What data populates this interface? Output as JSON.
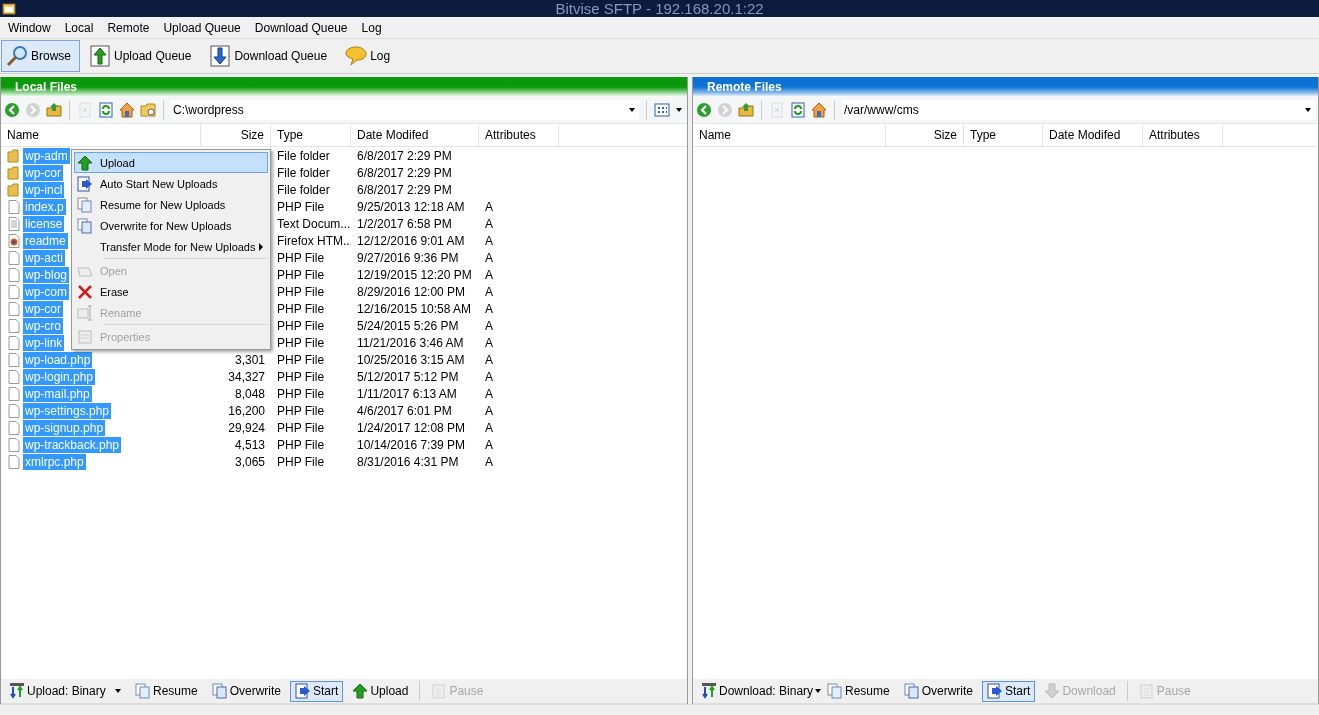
{
  "window": {
    "title": "Bitvise SFTP - 192.168.20.1:22"
  },
  "menu_bar": [
    "Window",
    "Local",
    "Remote",
    "Upload Queue",
    "Download Queue",
    "Log"
  ],
  "toolbar": [
    {
      "label": "Browse",
      "selected": true
    },
    {
      "label": "Upload Queue",
      "selected": false
    },
    {
      "label": "Download Queue",
      "selected": false
    },
    {
      "label": "Log",
      "selected": false
    }
  ],
  "panels": [
    {
      "header": "Local Files",
      "path": "C:\\wordpress",
      "columns": [
        "Name",
        "Size",
        "Type",
        "Date Modifed",
        "Attributes"
      ],
      "rows": [
        {
          "name": "wp-adm",
          "type": "File folder",
          "date": "6/8/2017 2:29 PM",
          "kind": "folder",
          "selected": true
        },
        {
          "name": "wp-cor",
          "type": "File folder",
          "date": "6/8/2017 2:29 PM",
          "kind": "folder",
          "selected": true
        },
        {
          "name": "wp-incl",
          "type": "File folder",
          "date": "6/8/2017 2:29 PM",
          "kind": "folder",
          "selected": true
        },
        {
          "name": "index.p",
          "type": "PHP File",
          "date": "9/25/2013 12:18 AM",
          "attributes": "A",
          "kind": "file",
          "selected": true
        },
        {
          "name": "license",
          "type": "Text Docum...",
          "date": "1/2/2017 6:58 PM",
          "attributes": "A",
          "kind": "text",
          "selected": true
        },
        {
          "name": "readme",
          "type": "Firefox HTM...",
          "date": "12/12/2016 9:01 AM",
          "attributes": "A",
          "kind": "html",
          "selected": true
        },
        {
          "name": "wp-acti",
          "type": "PHP File",
          "date": "9/27/2016 9:36 PM",
          "attributes": "A",
          "kind": "file",
          "selected": true
        },
        {
          "name": "wp-blog",
          "type": "PHP File",
          "date": "12/19/2015 12:20 PM",
          "attributes": "A",
          "kind": "file",
          "selected": true
        },
        {
          "name": "wp-com",
          "type": "PHP File",
          "date": "8/29/2016 12:00 PM",
          "attributes": "A",
          "kind": "file",
          "selected": true
        },
        {
          "name": "wp-cor",
          "type": "PHP File",
          "date": "12/16/2015 10:58 AM",
          "attributes": "A",
          "kind": "file",
          "selected": true
        },
        {
          "name": "wp-cro",
          "type": "PHP File",
          "date": "5/24/2015 5:26 PM",
          "attributes": "A",
          "kind": "file",
          "selected": true
        },
        {
          "name": "wp-link",
          "type": "PHP File",
          "date": "11/21/2016 3:46 AM",
          "attributes": "A",
          "kind": "file",
          "selected": true
        },
        {
          "name": "wp-load.php",
          "size": "3,301",
          "type": "PHP File",
          "date": "10/25/2016 3:15 AM",
          "attributes": "A",
          "kind": "file",
          "selected": true
        },
        {
          "name": "wp-login.php",
          "size": "34,327",
          "type": "PHP File",
          "date": "5/12/2017 5:12 PM",
          "attributes": "A",
          "kind": "file",
          "selected": true
        },
        {
          "name": "wp-mail.php",
          "size": "8,048",
          "type": "PHP File",
          "date": "1/11/2017 6:13 AM",
          "attributes": "A",
          "kind": "file",
          "selected": true
        },
        {
          "name": "wp-settings.php",
          "size": "16,200",
          "type": "PHP File",
          "date": "4/6/2017 6:01 PM",
          "attributes": "A",
          "kind": "file",
          "selected": true
        },
        {
          "name": "wp-signup.php",
          "size": "29,924",
          "type": "PHP File",
          "date": "1/24/2017 12:08 PM",
          "attributes": "A",
          "kind": "file",
          "selected": true
        },
        {
          "name": "wp-trackback.php",
          "size": "4,513",
          "type": "PHP File",
          "date": "10/14/2016 7:39 PM",
          "attributes": "A",
          "kind": "file",
          "selected": true
        },
        {
          "name": "xmlrpc.php",
          "size": "3,065",
          "type": "PHP File",
          "date": "8/31/2016 4:31 PM",
          "attributes": "A",
          "kind": "file",
          "selected": true
        }
      ],
      "bottom_bar": [
        {
          "label": "Upload: Binary",
          "kind": "mode",
          "disabled": false,
          "selected": false
        },
        {
          "label": "Resume",
          "kind": "button",
          "disabled": false,
          "selected": false
        },
        {
          "label": "Overwrite",
          "kind": "button",
          "disabled": false,
          "selected": false
        },
        {
          "label": "Start",
          "kind": "button",
          "disabled": false,
          "selected": true
        },
        {
          "label": "Upload",
          "kind": "button",
          "disabled": false,
          "selected": false
        },
        {
          "kind": "separator"
        },
        {
          "label": "Pause",
          "kind": "button",
          "disabled": true,
          "selected": false
        }
      ]
    },
    {
      "header": "Remote Files",
      "path": "/var/www/cms",
      "columns": [
        "Name",
        "Size",
        "Type",
        "Date Modifed",
        "Attributes"
      ],
      "bottom_bar": [
        {
          "label": "Download: Binary",
          "kind": "mode",
          "disabled": false,
          "selected": false
        },
        {
          "label": "Resume",
          "kind": "button",
          "disabled": false,
          "selected": false
        },
        {
          "label": "Overwrite",
          "kind": "button",
          "disabled": false,
          "selected": false
        },
        {
          "label": "Start",
          "kind": "button",
          "disabled": false,
          "selected": true
        },
        {
          "label": "Download",
          "kind": "button",
          "disabled": true,
          "selected": false
        },
        {
          "kind": "separator"
        },
        {
          "label": "Pause",
          "kind": "button",
          "disabled": true,
          "selected": false
        }
      ]
    }
  ],
  "context_menu": [
    {
      "kind": "item",
      "label": "Upload",
      "highlighted": true,
      "disabled": false,
      "submenu": false
    },
    {
      "kind": "item",
      "label": "Auto Start New Uploads",
      "highlighted": false,
      "disabled": false,
      "submenu": false
    },
    {
      "kind": "item",
      "label": "Resume for New Uploads",
      "highlighted": false,
      "disabled": false,
      "submenu": false
    },
    {
      "kind": "item",
      "label": "Overwrite for New Uploads",
      "highlighted": false,
      "disabled": false,
      "submenu": false
    },
    {
      "kind": "item",
      "label": "Transfer Mode for New Uploads",
      "highlighted": false,
      "disabled": false,
      "submenu": true
    },
    {
      "kind": "separator"
    },
    {
      "kind": "item",
      "label": "Open",
      "highlighted": false,
      "disabled": true,
      "submenu": false
    },
    {
      "kind": "item",
      "label": "Erase",
      "highlighted": false,
      "disabled": false,
      "submenu": false
    },
    {
      "kind": "item",
      "label": "Rename",
      "highlighted": false,
      "disabled": true,
      "submenu": false
    },
    {
      "kind": "separator"
    },
    {
      "kind": "item",
      "label": "Properties",
      "highlighted": false,
      "disabled": true,
      "submenu": false
    }
  ]
}
